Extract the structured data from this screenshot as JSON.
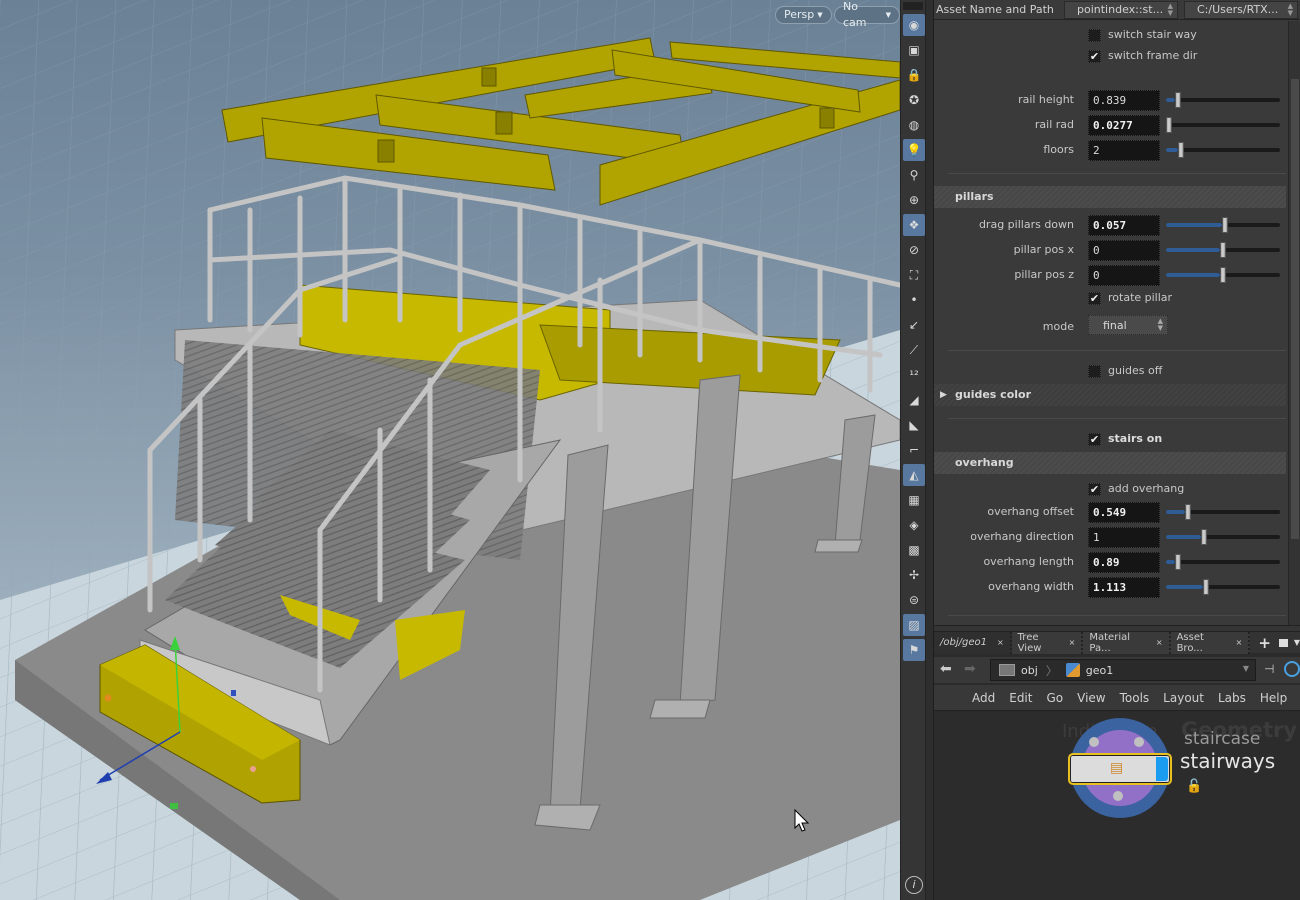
{
  "viewport": {
    "view_mode": "Persp",
    "camera": "No cam",
    "dropdown_icon": "caret-down-icon"
  },
  "toolshelf": {
    "tools": [
      {
        "name": "display-options-icon",
        "glyph": "◉",
        "active": true
      },
      {
        "name": "ghost-other-objects-icon",
        "glyph": "▣",
        "active": false
      },
      {
        "name": "lock-camera-icon",
        "glyph": "🔒",
        "active": false
      },
      {
        "name": "headlight-icon",
        "glyph": "✪",
        "active": false
      },
      {
        "name": "default-light-icon",
        "glyph": "◍",
        "active": false
      },
      {
        "name": "lighting-icon",
        "glyph": "💡",
        "active": true
      },
      {
        "name": "normal-light-icon",
        "glyph": "⚲",
        "active": false
      },
      {
        "name": "high-quality-light-icon",
        "glyph": "⊕",
        "active": false
      },
      {
        "name": "shading-icon",
        "glyph": "❖",
        "active": true
      },
      {
        "name": "visibility-icon",
        "glyph": "⊘",
        "active": false
      },
      {
        "name": "display-set-icon",
        "glyph": "⛶",
        "active": false
      },
      {
        "name": "points-icon",
        "glyph": "•",
        "active": false
      },
      {
        "name": "point-normals-icon",
        "glyph": "↙",
        "active": false
      },
      {
        "name": "point-markers-icon",
        "glyph": "⟋",
        "active": false
      },
      {
        "name": "point-numbers-icon",
        "glyph": "¹²",
        "active": false
      },
      {
        "name": "primitive-normals-icon",
        "glyph": "◢",
        "active": false
      },
      {
        "name": "primitive-numbers-icon",
        "glyph": "◣",
        "active": false
      },
      {
        "name": "edge-icon",
        "glyph": "⌐",
        "active": false
      },
      {
        "name": "backface-icon",
        "glyph": "◭",
        "active": true
      },
      {
        "name": "uv-checker-icon",
        "glyph": "▦",
        "active": false
      },
      {
        "name": "templates-icon",
        "glyph": "◈",
        "active": false
      },
      {
        "name": "guide-geometry-icon",
        "glyph": "▩",
        "active": false
      },
      {
        "name": "origin-axes-icon",
        "glyph": "✢",
        "active": false
      },
      {
        "name": "safe-area-icon",
        "glyph": "⊜",
        "active": false
      },
      {
        "name": "background-image-icon",
        "glyph": "▨",
        "active": true
      },
      {
        "name": "location-pin-icon",
        "glyph": "⚑",
        "active": true
      }
    ],
    "info_icon": "ⓘ"
  },
  "parameters": {
    "header": {
      "label": "Asset Name and Path",
      "asset_name": "pointindex::st...",
      "asset_path": "C:/Users/RTX..."
    },
    "switch_stair_way": {
      "label": "switch stair way",
      "checked": false
    },
    "switch_frame_dir": {
      "label": "switch frame dir",
      "checked": true
    },
    "rail_height": {
      "label": "rail height",
      "value": "0.839",
      "fraction": 0.08
    },
    "rail_rad": {
      "label": "rail rad",
      "value": "0.0277",
      "fraction": 0.0
    },
    "floors": {
      "label": "floors",
      "value": "2",
      "fraction": 0.11
    },
    "pillars_folder": "pillars",
    "drag_pillars_down": {
      "label": "drag pillars down",
      "value": "0.057",
      "fraction": 0.52
    },
    "pillar_pos_x": {
      "label": "pillar pos x",
      "value": "0",
      "fraction": 0.5
    },
    "pillar_pos_z": {
      "label": "pillar pos z",
      "value": "0",
      "fraction": 0.5
    },
    "rotate_pillar": {
      "label": "rotate pillar",
      "checked": true
    },
    "mode": {
      "label": "mode",
      "value": "final"
    },
    "guides_off": {
      "label": "guides off",
      "checked": false
    },
    "guides_color_folder": "guides color",
    "stairs_on": {
      "label": "stairs on",
      "checked": true
    },
    "overhang_folder": "overhang",
    "add_overhang": {
      "label": "add overhang",
      "checked": true
    },
    "overhang_offset": {
      "label": "overhang offset",
      "value": "0.549",
      "fraction": 0.18
    },
    "overhang_direction": {
      "label": "overhang direction",
      "value": "1",
      "fraction": 0.32
    },
    "overhang_length": {
      "label": "overhang length",
      "value": "0.89",
      "fraction": 0.08
    },
    "overhang_width": {
      "label": "overhang width",
      "value": "1.113",
      "fraction": 0.34
    },
    "check_glyph": "✔"
  },
  "network": {
    "tabs": [
      {
        "label": "/obj/geo1"
      },
      {
        "label": "Tree View"
      },
      {
        "label": "Material Pa..."
      },
      {
        "label": "Asset Bro..."
      }
    ],
    "tab_close": "×",
    "add_tab": "+",
    "path": [
      {
        "label": "obj"
      },
      {
        "label": "geo1"
      }
    ],
    "menu": [
      "Add",
      "Edit",
      "Go",
      "View",
      "Tools",
      "Layout",
      "Labs",
      "Help"
    ],
    "watermark_left": "Indirection",
    "watermark_right": "Geometry",
    "node": {
      "type_label": "staircase",
      "name": "stairways",
      "lock_icon": "🔓"
    }
  }
}
